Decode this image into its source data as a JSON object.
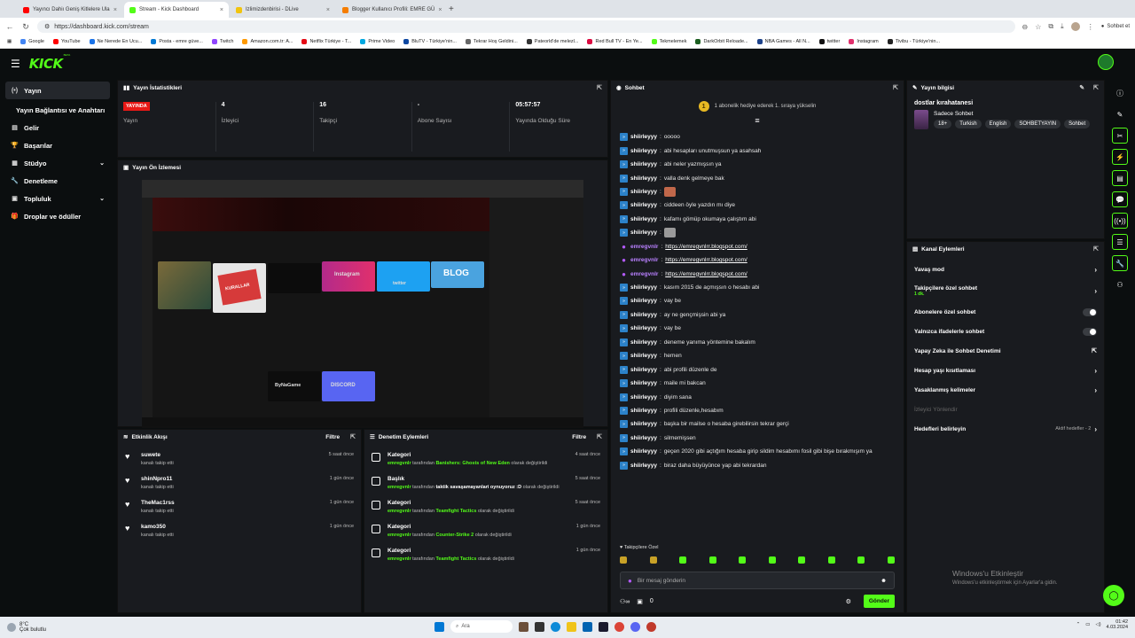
{
  "browser": {
    "tabs": [
      {
        "label": "Yayıncı Dahiı Geniş Kitlelere Ula",
        "color": "#ff0000",
        "active": false
      },
      {
        "label": "Stream - Kick Dashboard",
        "color": "#53fc18",
        "active": true
      },
      {
        "label": "Izlimizdenbirisi - DLive",
        "color": "#f1c40f",
        "active": false
      },
      {
        "label": "Blogger Kullanıcı Profili: EMRE GÜ",
        "color": "#f57d00",
        "active": false
      }
    ],
    "url": "https://dashboard.kick.com/stream",
    "sohbet_label": "Sohbet et",
    "bookmarks": [
      {
        "label": "Google",
        "color": "#4285f4"
      },
      {
        "label": "YouTube",
        "color": "#ff0000"
      },
      {
        "label": "Ne Nerede En Ucu...",
        "color": "#1a73e8"
      },
      {
        "label": "Posta - emre güve...",
        "color": "#0078d4"
      },
      {
        "label": "Twitch",
        "color": "#9146ff"
      },
      {
        "label": "Amazon.com.tr: A...",
        "color": "#ff9900"
      },
      {
        "label": "Netflix Türkiye - T...",
        "color": "#e50914"
      },
      {
        "label": "Prime Video",
        "color": "#00a8e1"
      },
      {
        "label": "BluTV - Türkiye'nin...",
        "color": "#0d47a1"
      },
      {
        "label": "Tekrar Hoş Geldini...",
        "color": "#666666"
      },
      {
        "label": "Pateorld'de melezl...",
        "color": "#333333"
      },
      {
        "label": "Red Bull TV - En Ye...",
        "color": "#db0a40"
      },
      {
        "label": "Tekmelemek",
        "color": "#53fc18"
      },
      {
        "label": "DarkOrbit Reloade...",
        "color": "#1b5e20"
      },
      {
        "label": "NBA Games - All N...",
        "color": "#1d428a"
      },
      {
        "label": "twitter",
        "color": "#111111"
      },
      {
        "label": "Instagram",
        "color": "#e1306c"
      },
      {
        "label": "Tivibu - Türkiye'nin...",
        "color": "#222222"
      }
    ]
  },
  "app": {
    "logo": "KICK",
    "beta": "BETA",
    "accent": "#53fc18"
  },
  "sidebar": {
    "items": [
      {
        "label": "Yayın",
        "icon": "broadcast-icon",
        "glyph": "(•)",
        "active": true,
        "chevron": false
      },
      {
        "label": "Yayın Bağlantısı ve Anahtarı",
        "icon": "key-icon",
        "glyph": "",
        "active": false,
        "chevron": false
      },
      {
        "label": "Gelir",
        "icon": "wallet-icon",
        "glyph": "▤",
        "active": false,
        "chevron": false
      },
      {
        "label": "Başarılar",
        "icon": "trophy-icon",
        "glyph": "🏆",
        "active": false,
        "chevron": false
      },
      {
        "label": "Stüdyo",
        "icon": "studio-icon",
        "glyph": "▦",
        "active": false,
        "chevron": true
      },
      {
        "label": "Denetleme",
        "icon": "wrench-icon",
        "glyph": "🔧",
        "active": false,
        "chevron": false
      },
      {
        "label": "Topluluk",
        "icon": "community-icon",
        "glyph": "▣",
        "active": false,
        "chevron": true
      },
      {
        "label": "Droplar ve ödüller",
        "icon": "gift-icon",
        "glyph": "🎁",
        "active": false,
        "chevron": false
      }
    ]
  },
  "stats": {
    "title": "Yayın İstatistikleri",
    "live_badge": "YAYINDA",
    "items": [
      {
        "value": "",
        "label": "Yayın"
      },
      {
        "value": "4",
        "label": "İzleyici"
      },
      {
        "value": "16",
        "label": "Takipçi"
      },
      {
        "value": "-",
        "label": "Abone Sayısı"
      },
      {
        "value": "05:57:57",
        "label": "Yayında Olduğu Süre"
      }
    ]
  },
  "preview": {
    "title": "Yayın Ön İzlemesi",
    "cards": [
      "",
      "KURALLAR",
      "",
      "Instagram",
      "twitter",
      "BLOG",
      "ByNaGame",
      "DISCORD"
    ]
  },
  "activity": {
    "title": "Etkinlik Akışı",
    "filter": "Filtre",
    "items": [
      {
        "name": "suwete",
        "sub": "kanalı takip etti",
        "time": "5 saat önce"
      },
      {
        "name": "shinNpro11",
        "sub": "kanalı takip etti",
        "time": "1 gün önce"
      },
      {
        "name": "TheMac1rss",
        "sub": "kanalı takip etti",
        "time": "1 gün önce"
      },
      {
        "name": "kamo350",
        "sub": "kanalı takip etti",
        "time": "1 gün önce"
      }
    ]
  },
  "moderation": {
    "title": "Denetim Eylemleri",
    "filter": "Filtre",
    "items": [
      {
        "title": "Kategori",
        "user": "emregvnlr",
        "mid": "tarafından",
        "value": "Banishers: Ghosts of New Eden",
        "end": "olarak değiştirildi",
        "time": "4 saat önce"
      },
      {
        "title": "Başlık",
        "user": "emregvnlr",
        "mid": "tarafından",
        "value": "taktik savaşamayanlari oynuyoruz :D",
        "end": "olarak değiştirildi",
        "time": "5 saat önce"
      },
      {
        "title": "Kategori",
        "user": "emregvnlr",
        "mid": "tarafından",
        "value": "Teamfight Tactics",
        "end": "olarak değiştirildi",
        "time": "5 saat önce"
      },
      {
        "title": "Kategori",
        "user": "emregvnlr",
        "mid": "tarafından",
        "value": "Counter-Strike 2",
        "end": "olarak değiştirildi",
        "time": "1 gün önce"
      },
      {
        "title": "Kategori",
        "user": "emregvnlr",
        "mid": "tarafından",
        "value": "Teamfight Tactics",
        "end": "olarak değiştirildi",
        "time": "1 gün önce"
      }
    ]
  },
  "chat": {
    "title": "Sohbet",
    "gift_text": "1 abonelik hediye ederek 1. sıraya yükselin",
    "gift_coin": "1",
    "messages": [
      {
        "user": "shiirleyyy",
        "text": "ooooo",
        "kind": "user",
        "link": false,
        "emoji": ""
      },
      {
        "user": "shiirleyyy",
        "text": "abi hesapları unutmuşsun ya asahsah",
        "kind": "user",
        "link": false,
        "emoji": ""
      },
      {
        "user": "shiirleyyy",
        "text": "abi neler yazmışsın ya",
        "kind": "user",
        "link": false,
        "emoji": ""
      },
      {
        "user": "shiirleyyy",
        "text": "valla denk gelmeye bak",
        "kind": "user",
        "link": false,
        "emoji": ""
      },
      {
        "user": "shiirleyyy",
        "text": "",
        "kind": "user",
        "link": false,
        "emoji": "#c0674a"
      },
      {
        "user": "shiirleyyy",
        "text": "ciddeen öyle yazdın mı diye",
        "kind": "user",
        "link": false,
        "emoji": ""
      },
      {
        "user": "shiirleyyy",
        "text": "kafamı gömüp okumaya çalıştım abi",
        "kind": "user",
        "link": false,
        "emoji": ""
      },
      {
        "user": "shiirleyyy",
        "text": "",
        "kind": "user",
        "link": false,
        "emoji": "#9a9a9a"
      },
      {
        "user": "emregvnlr",
        "text": "https://emregvnlrr.blogspot.com/",
        "kind": "owner",
        "link": true,
        "emoji": ""
      },
      {
        "user": "emregvnlr",
        "text": "https://emregvnlrr.blogspot.com/",
        "kind": "owner",
        "link": true,
        "emoji": ""
      },
      {
        "user": "emregvnlr",
        "text": "https://emregvnlrr.blogspot.com/",
        "kind": "owner",
        "link": true,
        "emoji": ""
      },
      {
        "user": "shiirleyyy",
        "text": "kasım 2015 de açmışsın o hesabı abi",
        "kind": "user",
        "link": false,
        "emoji": ""
      },
      {
        "user": "shiirleyyy",
        "text": "vay be",
        "kind": "user",
        "link": false,
        "emoji": ""
      },
      {
        "user": "shiirleyyy",
        "text": "ay ne gençmişsin abi ya",
        "kind": "user",
        "link": false,
        "emoji": ""
      },
      {
        "user": "shiirleyyy",
        "text": "vay be",
        "kind": "user",
        "link": false,
        "emoji": ""
      },
      {
        "user": "shiirleyyy",
        "text": "deneme yanıma yöntemine bakalım",
        "kind": "user",
        "link": false,
        "emoji": ""
      },
      {
        "user": "shiirleyyy",
        "text": "hemen",
        "kind": "user",
        "link": false,
        "emoji": ""
      },
      {
        "user": "shiirleyyy",
        "text": "abi profili düzenle de",
        "kind": "user",
        "link": false,
        "emoji": ""
      },
      {
        "user": "shiirleyyy",
        "text": "maile mi bakcan",
        "kind": "user",
        "link": false,
        "emoji": ""
      },
      {
        "user": "shiirleyyy",
        "text": "diyim sana",
        "kind": "user",
        "link": false,
        "emoji": ""
      },
      {
        "user": "shiirleyyy",
        "text": "profili düzenle,hesabım",
        "kind": "user",
        "link": false,
        "emoji": ""
      },
      {
        "user": "shiirleyyy",
        "text": "başka bir mailse o hesaba girebilirsin tekrar gerçi",
        "kind": "user",
        "link": false,
        "emoji": ""
      },
      {
        "user": "shiirleyyy",
        "text": "silmemişsen",
        "kind": "user",
        "link": false,
        "emoji": ""
      },
      {
        "user": "shiirleyyy",
        "text": "geçen 2020 gibi açtığım hesaba girip sildim hesabımı fosil gibi bişe bırakmışım ya",
        "kind": "user",
        "link": false,
        "emoji": ""
      },
      {
        "user": "shiirleyyy",
        "text": "biraz daha büyüyünce yap abi tekrardan",
        "kind": "user",
        "link": false,
        "emoji": ""
      }
    ],
    "followers_only_label": "Takipçilere Özel",
    "input_placeholder": "Bir mesaj gönderin",
    "points": "0",
    "send_label": "Gönder"
  },
  "stream_info": {
    "title": "Yayın bilgisi",
    "stream_title": "dostlar kırahatanesi",
    "category": "Sadece Sohbet",
    "tags": [
      "18+",
      "Turkish",
      "English",
      "SOHBETYAYIN",
      "Sohbet"
    ]
  },
  "channel_actions": {
    "title": "Kanal Eylemleri",
    "items": [
      {
        "label": "Yavaş mod",
        "control": "chevron",
        "sub": "",
        "right": ""
      },
      {
        "label": "Takipçilere özel sohbet",
        "control": "chevron",
        "sub": "1 dk.",
        "right": ""
      },
      {
        "label": "Abonelere özel sohbet",
        "control": "toggle",
        "sub": "",
        "right": ""
      },
      {
        "label": "Yalnızca ifadelerle sohbet",
        "control": "toggle",
        "sub": "",
        "right": ""
      },
      {
        "label": "Yapay Zeka ile Sohbet Denetimi",
        "control": "external",
        "sub": "",
        "right": ""
      },
      {
        "label": "Hesap yaşı kısıtlaması",
        "control": "chevron",
        "sub": "",
        "right": ""
      },
      {
        "label": "Yasaklanmış kelimeler",
        "control": "chevron",
        "sub": "",
        "right": ""
      },
      {
        "label": "İzleyici Yönlendir",
        "control": "none",
        "sub": "",
        "right": "",
        "dim": true
      },
      {
        "label": "Hedefleri belirleyin",
        "control": "chevron",
        "sub": "",
        "right": "Aktif hedefler - 2"
      }
    ]
  },
  "watermark": {
    "line1": "Windows'u Etkinleştir",
    "line2": "Windows'u etkinleştirmek için Ayarlar'a gidin."
  },
  "taskbar": {
    "weather_temp": "8°C",
    "weather_text": "Çok bulutlu",
    "search_placeholder": "Ara",
    "time": "01:42",
    "date": "4.03.2024"
  }
}
